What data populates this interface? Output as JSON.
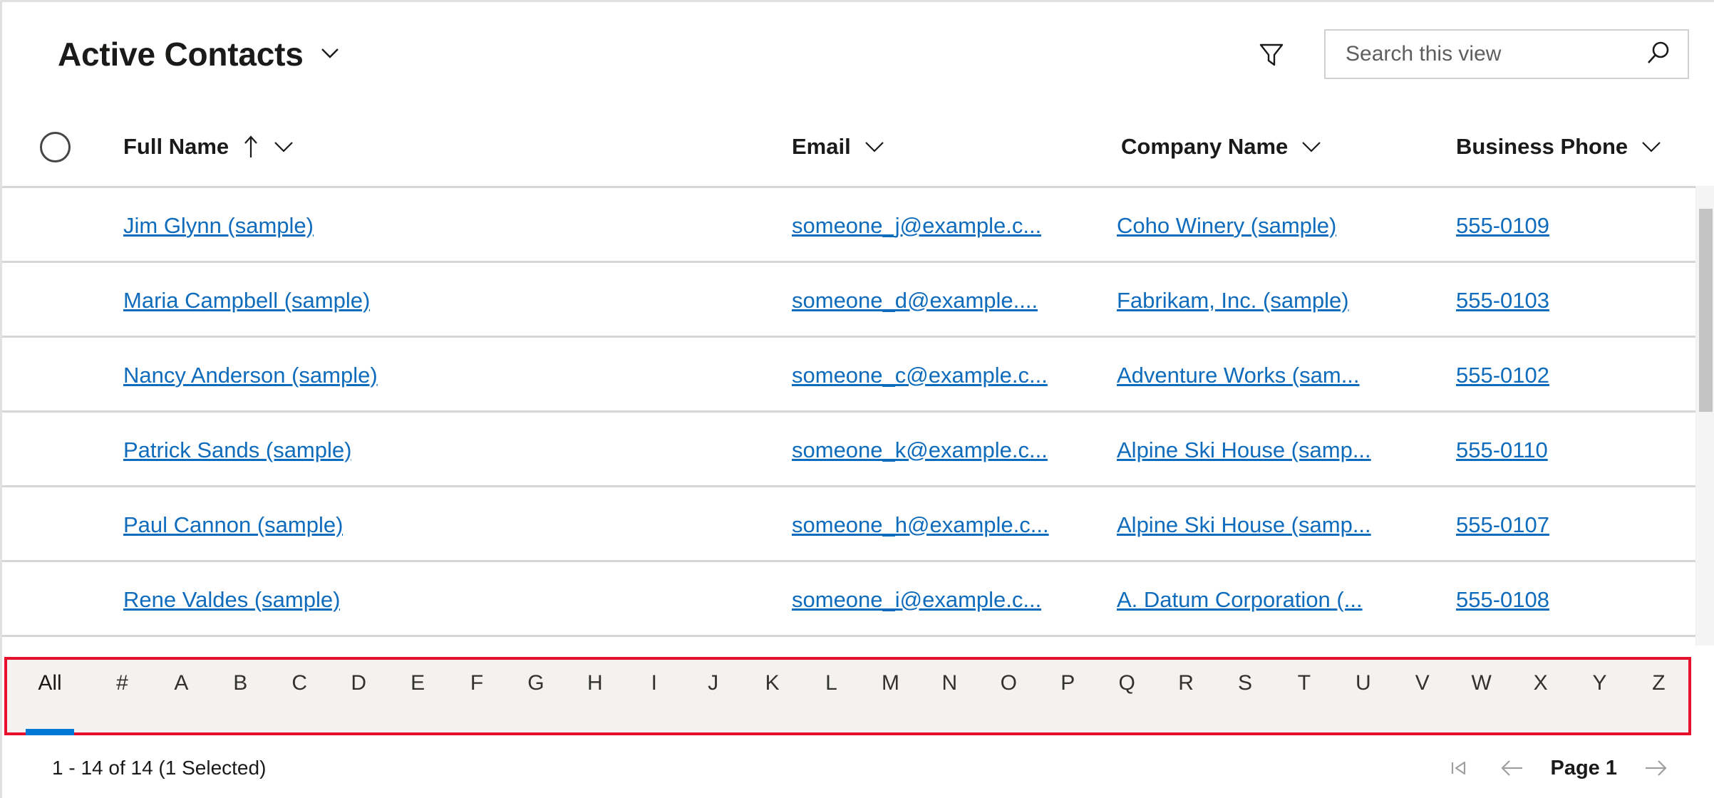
{
  "header": {
    "view_title": "Active Contacts",
    "view_chevron_icon": "chevron-down-icon",
    "filter_icon": "filter-funnel-icon",
    "search_placeholder": "Search this view",
    "search_value": "",
    "search_icon": "search-magnifier-icon"
  },
  "grid": {
    "select_all_icon": "select-all-circle-icon",
    "columns": [
      {
        "label": "Full Name",
        "sort": "ascending",
        "sort_icon": "arrow-up-icon",
        "chevron_icon": "chevron-down-icon"
      },
      {
        "label": "Email",
        "sort": "none",
        "chevron_icon": "chevron-down-icon"
      },
      {
        "label": "Company Name",
        "sort": "none",
        "chevron_icon": "chevron-down-icon"
      },
      {
        "label": "Business Phone",
        "sort": "none",
        "chevron_icon": "chevron-down-icon"
      }
    ],
    "rows": [
      {
        "full_name": "Jim Glynn (sample)",
        "email": "someone_j@example.c...",
        "company": "Coho Winery (sample)",
        "phone": "555-0109"
      },
      {
        "full_name": "Maria Campbell (sample)",
        "email": "someone_d@example....",
        "company": "Fabrikam, Inc. (sample)",
        "phone": "555-0103"
      },
      {
        "full_name": "Nancy Anderson (sample)",
        "email": "someone_c@example.c...",
        "company": "Adventure Works (sam...",
        "phone": "555-0102"
      },
      {
        "full_name": "Patrick Sands (sample)",
        "email": "someone_k@example.c...",
        "company": "Alpine Ski House (samp...",
        "phone": "555-0110"
      },
      {
        "full_name": "Paul Cannon (sample)",
        "email": "someone_h@example.c...",
        "company": "Alpine Ski House (samp...",
        "phone": "555-0107"
      },
      {
        "full_name": "Rene Valdes (sample)",
        "email": "someone_i@example.c...",
        "company": "A. Datum Corporation (...",
        "phone": "555-0108"
      }
    ]
  },
  "alpha_filter": {
    "highlight_color": "#e8112d",
    "selected": "All",
    "accent_color": "#0078d4",
    "items": [
      "All",
      "#",
      "A",
      "B",
      "C",
      "D",
      "E",
      "F",
      "G",
      "H",
      "I",
      "J",
      "K",
      "L",
      "M",
      "N",
      "O",
      "P",
      "Q",
      "R",
      "S",
      "T",
      "U",
      "V",
      "W",
      "X",
      "Y",
      "Z"
    ]
  },
  "footer": {
    "record_count": "1 - 14 of 14 (1 Selected)",
    "page_label": "Page 1",
    "first_page_icon": "first-page-icon",
    "prev_page_icon": "arrow-left-icon",
    "next_page_icon": "arrow-right-icon"
  }
}
